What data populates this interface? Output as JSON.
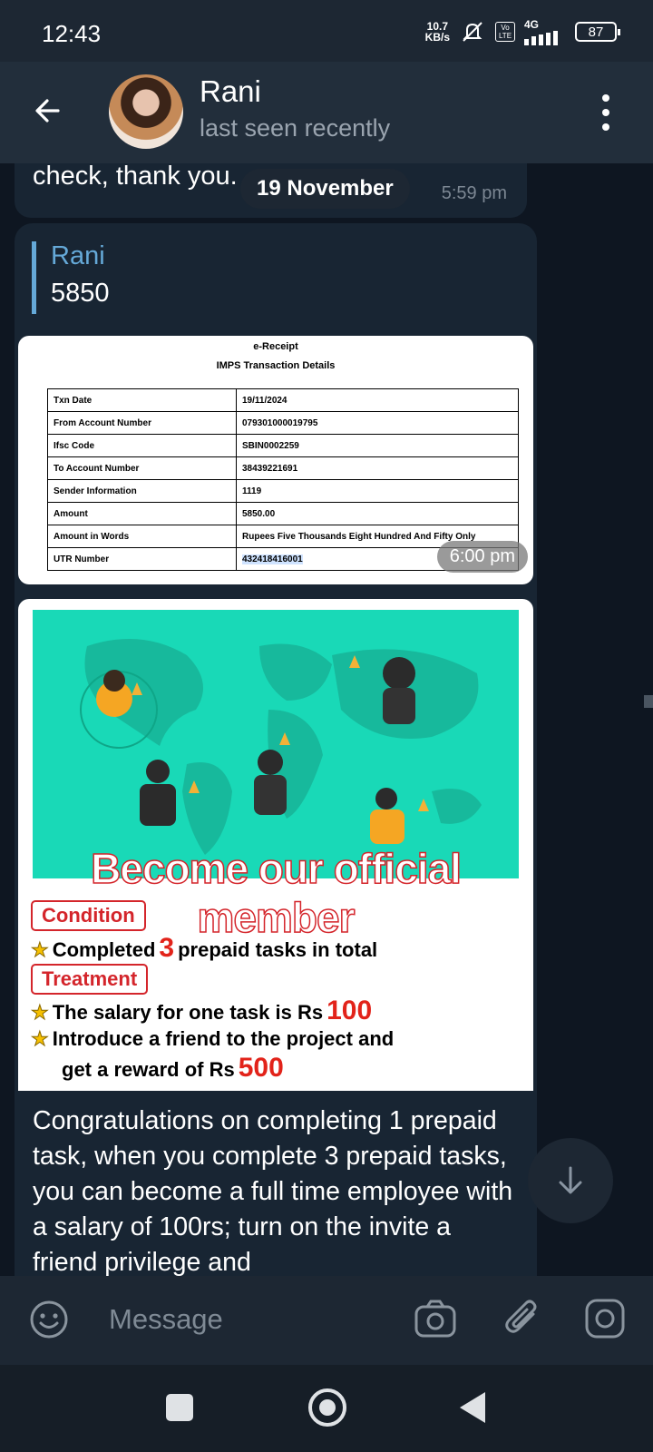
{
  "status_bar": {
    "time": "12:43",
    "net_speed_value": "10.7",
    "net_speed_unit": "KB/s",
    "volte": "Vo LTE",
    "network": "4G",
    "battery": "87"
  },
  "header": {
    "name": "Rani",
    "status": "last seen recently"
  },
  "messages": {
    "m1": {
      "text": "check, thank you.",
      "time": "5:59 pm"
    },
    "date_separator": "19 November",
    "reply": {
      "name": "Rani",
      "value": "5850"
    },
    "receipt": {
      "title": "e-Receipt",
      "subtitle": "IMPS Transaction Details",
      "rows": [
        {
          "label": "Txn Date",
          "value": "19/11/2024"
        },
        {
          "label": "From Account Number",
          "value": "079301000019795"
        },
        {
          "label": "Ifsc Code",
          "value": "SBIN0002259"
        },
        {
          "label": "To Account Number",
          "value": "38439221691"
        },
        {
          "label": "Sender Information",
          "value": "1119"
        },
        {
          "label": "Amount",
          "value": "5850.00"
        },
        {
          "label": "Amount in Words",
          "value": "Rupees Five Thousands Eight Hundred And Fifty Only"
        },
        {
          "label": "UTR Number",
          "value": "432418416001"
        }
      ],
      "time": "6:00 pm"
    },
    "promo": {
      "headline": "Become our official member",
      "condition_tag": "Condition",
      "line1_pre": "Completed",
      "line1_num": "3",
      "line1_post": "prepaid tasks in total",
      "treatment_tag": "Treatment",
      "line2_pre": "The salary for one task is Rs",
      "line2_num": "100",
      "line3": "Introduce a friend to the project and",
      "line4_pre": "get a reward of Rs",
      "line4_num": "500"
    },
    "caption": "Congratulations on completing 1 prepaid task, when you complete 3 prepaid tasks, you can become a full time employee with a salary of 100rs; turn on the invite a friend privilege and"
  },
  "composer": {
    "placeholder": "Message"
  },
  "icons": [
    "back-arrow-icon",
    "more-vert-icon",
    "emoji-icon",
    "camera-icon",
    "paperclip-icon",
    "instagram-icon",
    "scroll-down-icon"
  ]
}
